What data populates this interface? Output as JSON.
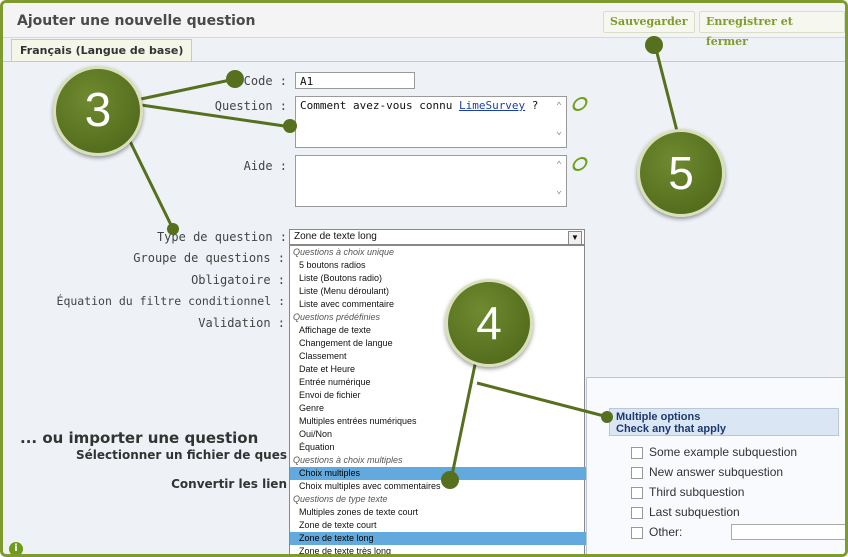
{
  "header": {
    "title": "Ajouter une nouvelle question",
    "save_label": "Sauvegarder",
    "save_close_label": "Enregistrer et fermer"
  },
  "tab": {
    "label": "Français (Langue de base)"
  },
  "form": {
    "code_label": "Code :",
    "code_value": "A1",
    "question_label": "Question :",
    "question_text_prefix": "Comment avez-vous connu ",
    "question_link": "LimeSurvey",
    "question_text_suffix": " ?",
    "help_label": "Aide :",
    "type_label": "Type de question :",
    "group_label": "Groupe de questions :",
    "mandatory_label": "Obligatoire :",
    "condition_label": "Équation du filtre conditionnel :",
    "validation_label": "Validation :",
    "type_selected": "Zone de texte long"
  },
  "dropdown": [
    {
      "text": "Questions à choix unique",
      "kind": "group"
    },
    {
      "text": "5 boutons radios",
      "kind": "option"
    },
    {
      "text": "Liste (Boutons radio)",
      "kind": "option"
    },
    {
      "text": "Liste (Menu déroulant)",
      "kind": "option"
    },
    {
      "text": "Liste avec commentaire",
      "kind": "option"
    },
    {
      "text": "Questions prédéfinies",
      "kind": "group"
    },
    {
      "text": "Affichage de texte",
      "kind": "option"
    },
    {
      "text": "Changement de langue",
      "kind": "option"
    },
    {
      "text": "Classement",
      "kind": "option"
    },
    {
      "text": "Date et Heure",
      "kind": "option"
    },
    {
      "text": "Entrée numérique",
      "kind": "option"
    },
    {
      "text": "Envoi de fichier",
      "kind": "option"
    },
    {
      "text": "Genre",
      "kind": "option"
    },
    {
      "text": "Multiples entrées numériques",
      "kind": "option"
    },
    {
      "text": "Oui/Non",
      "kind": "option"
    },
    {
      "text": "Équation",
      "kind": "option"
    },
    {
      "text": "Questions à choix multiples",
      "kind": "group"
    },
    {
      "text": "Choix multiples",
      "kind": "option",
      "selected": true
    },
    {
      "text": "Choix multiples avec commentaires",
      "kind": "option"
    },
    {
      "text": "Questions de type texte",
      "kind": "group"
    },
    {
      "text": "Multiples zones de texte court",
      "kind": "option"
    },
    {
      "text": "Zone de texte court",
      "kind": "option"
    },
    {
      "text": "Zone de texte long",
      "kind": "option",
      "selected": true
    },
    {
      "text": "Zone de texte très long",
      "kind": "option"
    }
  ],
  "import": {
    "title": "... ou importer une question",
    "file_label": "Sélectionner un fichier de ques",
    "convert_label": "Convertir les lien"
  },
  "preview": {
    "heading_line1": "Multiple options",
    "heading_line2": "Check any that apply",
    "items": [
      "Some example subquestion",
      "New answer subquestion",
      "Third subquestion",
      "Last subquestion"
    ],
    "other_label": "Other:"
  },
  "callouts": [
    "3",
    "4",
    "5"
  ],
  "info_icon": "i",
  "colors": {
    "accent": "#7f9b2e",
    "callout": "#56701e",
    "selection": "#62a9de"
  }
}
